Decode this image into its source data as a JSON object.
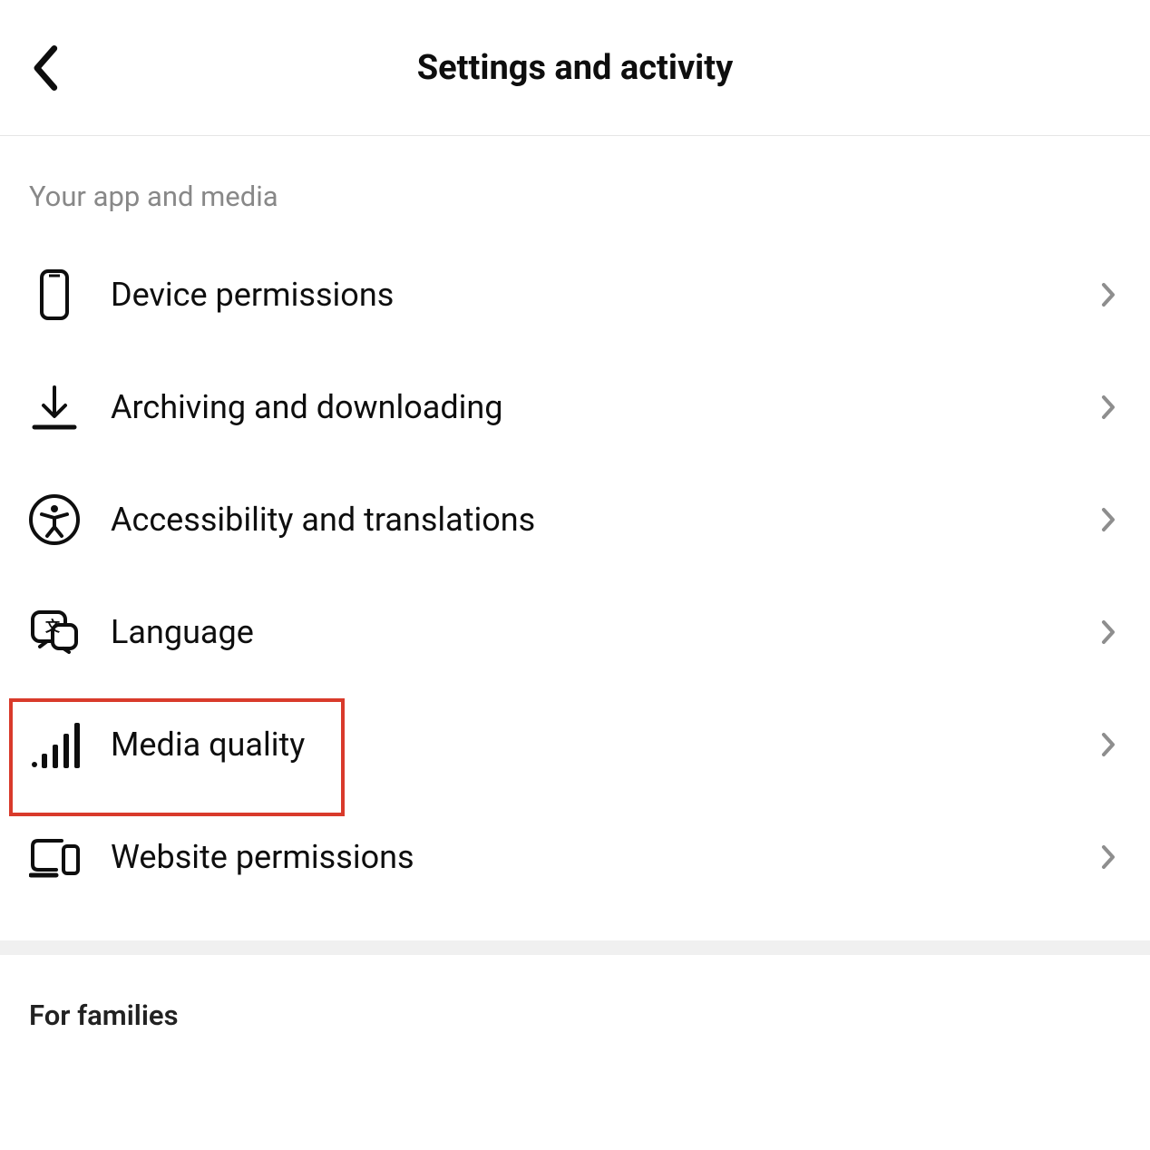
{
  "header": {
    "title": "Settings and activity"
  },
  "section1": {
    "title": "Your app and media",
    "items": [
      {
        "label": "Device permissions"
      },
      {
        "label": "Archiving and downloading"
      },
      {
        "label": "Accessibility and translations"
      },
      {
        "label": "Language"
      },
      {
        "label": "Media quality"
      },
      {
        "label": "Website permissions"
      }
    ]
  },
  "section2": {
    "title": "For families"
  }
}
